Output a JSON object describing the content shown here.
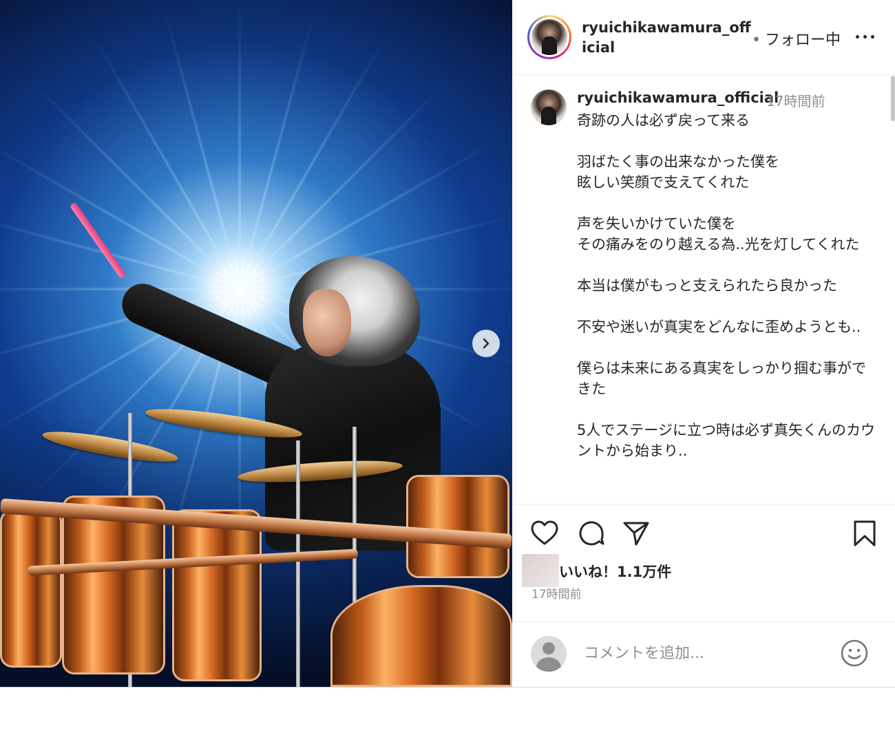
{
  "post": {
    "username_header": "ryuichikawamura_official",
    "follow_separator": "•",
    "follow_label": "フォロー中",
    "caption_username": "ryuichikawamura_official",
    "caption_time": "17時間前",
    "caption_paragraphs": [
      "奇跡の人は必ず戻って来る",
      "羽ばたく事の出来なかった僕を\n眩しい笑顔で支えてくれた",
      "声を失いかけていた僕を\nその痛みをのり越える為..光を灯してくれた",
      "本当は僕がもっと支えられたら良かった",
      "不安や迷いが真実をどんなに歪めようとも..",
      "僕らは未来にある真実をしっかり掴む事ができた",
      "5人でステージに立つ時は必ず真矢くんのカウントから始まり.."
    ],
    "likes_label": "いいね！1.1万件",
    "post_time": "17時間前",
    "comment_placeholder": "コメントを追加..."
  },
  "icons": {
    "next": "chevron-right-icon",
    "more": "more-horizontal-icon",
    "like": "heart-icon",
    "comment": "comment-bubble-icon",
    "share": "paper-plane-icon",
    "save": "bookmark-icon",
    "emoji": "emoji-smile-icon"
  },
  "colors": {
    "text": "#262626",
    "secondary": "#8e8e8e",
    "story_ring": [
      "#feda75",
      "#fa7e1e",
      "#d62976",
      "#962fbf",
      "#4f5bd5"
    ]
  }
}
